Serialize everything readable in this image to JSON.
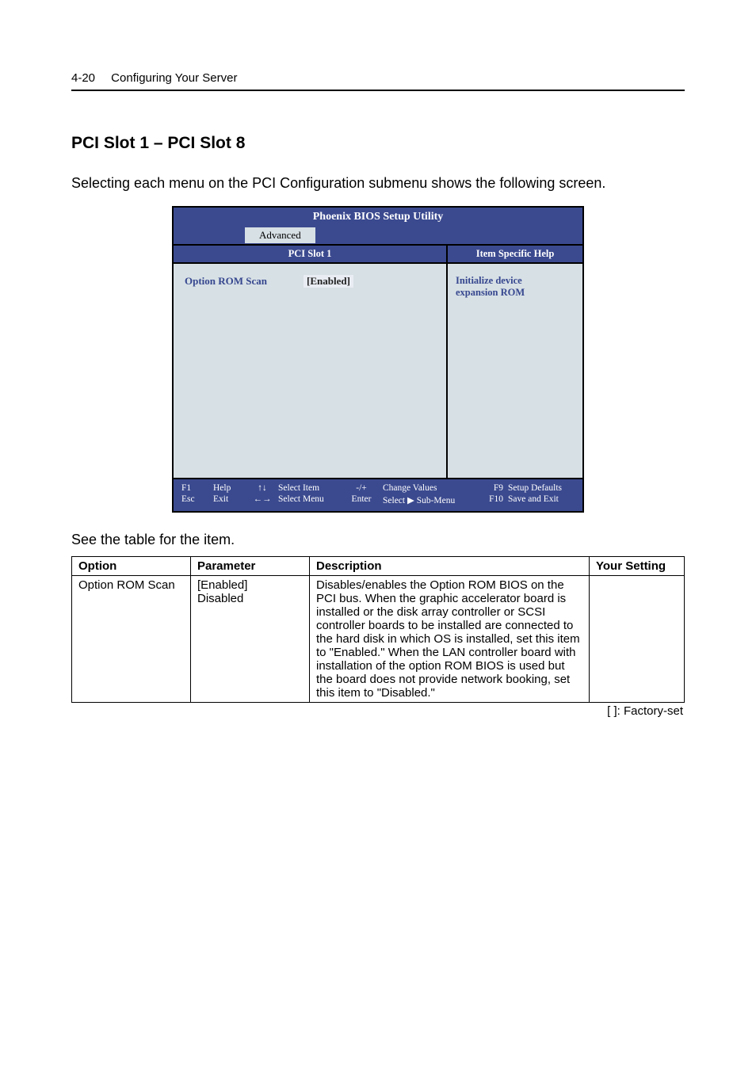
{
  "header": {
    "page_number": "4-20",
    "title": "Configuring Your Server"
  },
  "section_heading": "PCI Slot 1 – PCI Slot 8",
  "intro_text": "Selecting each menu on the PCI Configuration submenu shows the following screen.",
  "bios": {
    "title": "Phoenix BIOS Setup Utility",
    "active_tab": "Advanced",
    "left_panel_title": "PCI Slot 1",
    "right_panel_title": "Item Specific Help",
    "option_label": "Option ROM Scan",
    "option_value": "[Enabled]",
    "help_line1": "Initialize device",
    "help_line2": "expansion ROM",
    "footer": {
      "k1a": "F1",
      "k1b": "Esc",
      "l1a": "Help",
      "l1b": "Exit",
      "k2a": "↑↓",
      "k2b": "←→",
      "l2a": "Select Item",
      "l2b": "Select Menu",
      "k3a": "-/+",
      "k3b": "Enter",
      "l3a": "Change Values",
      "l3b": "Select   ▶ Sub-Menu",
      "k4a": "F9",
      "k4b": "F10",
      "l4a": "Setup Defaults",
      "l4b": "Save and Exit"
    }
  },
  "see_text": "See the table for the item.",
  "table": {
    "headers": {
      "option": "Option",
      "parameter": "Parameter",
      "description": "Description",
      "setting": "Your Setting"
    },
    "row": {
      "option": "Option ROM Scan",
      "param1": "[Enabled]",
      "param2": "Disabled",
      "description": "Disables/enables the Option ROM BIOS on the PCI bus. When the graphic accelerator board is installed or the disk array controller or SCSI controller boards to be installed are connected to the hard disk in which OS is installed, set this item to \"Enabled.\"    When the LAN controller board with installation of the option ROM BIOS is used but the board does not provide network booking, set this item to \"Disabled.\"",
      "setting": ""
    }
  },
  "legend": "[      ]: Factory-set"
}
